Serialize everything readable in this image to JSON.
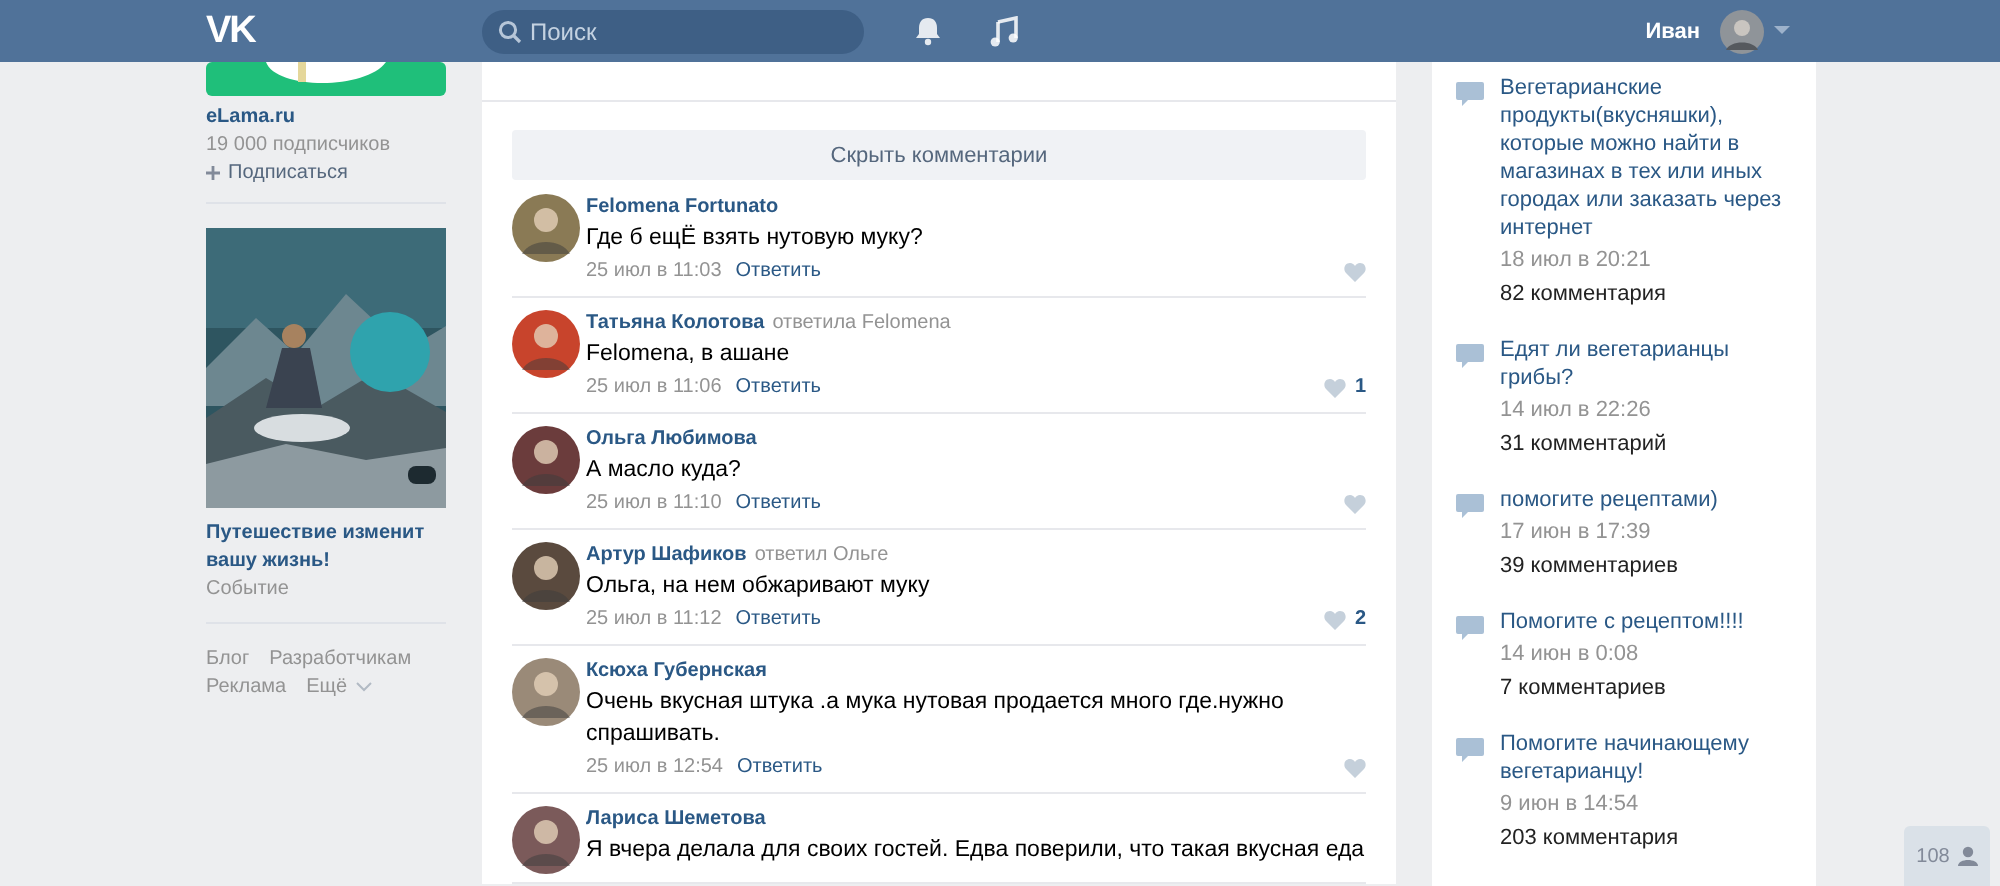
{
  "header": {
    "logo": "VK",
    "search": {
      "placeholder": "Поиск"
    },
    "user": {
      "name": "Иван"
    }
  },
  "left": {
    "group": {
      "name": "eLama.ru",
      "subscribers": "19 000 подписчиков",
      "subscribe": "Подписаться"
    },
    "ad": {
      "title": "Путешествие изменит вашу жизнь!",
      "type": "Событие"
    },
    "footer_links": [
      {
        "label": "Блог",
        "dropdown": false
      },
      {
        "label": "Разработчикам",
        "dropdown": false
      },
      {
        "label": "Реклама",
        "dropdown": false
      },
      {
        "label": "Ещё",
        "dropdown": true
      }
    ]
  },
  "post": {
    "hide_comments": "Скрыть комментарии",
    "comments": [
      {
        "author": "Felomena Fortunato",
        "text": "Где б ещЁ взять нутовую муку?",
        "date": "25 июл в 11:03",
        "reply": "Ответить"
      },
      {
        "author": "Татьяна Колотова",
        "reply_to": "ответила Felomena",
        "text": "Felomena, в ашане",
        "date": "25 июл в 11:06",
        "reply": "Ответить",
        "likes": "1"
      },
      {
        "author": "Ольга Любимова",
        "text": "А масло куда?",
        "date": "25 июл в 11:10",
        "reply": "Ответить"
      },
      {
        "author": "Артур Шафиков",
        "reply_to": "ответил Ольге",
        "text": "Ольга, на нем обжаривают муку",
        "date": "25 июл в 11:12",
        "reply": "Ответить",
        "likes": "2"
      },
      {
        "author": "Ксюха Губернская",
        "text": "Очень вкусная штука .а мука нутовая продается много где.нужно спрашивать.",
        "date": "25 июл в 12:54",
        "reply": "Ответить"
      },
      {
        "author": "Лариса Шеметова",
        "text": "Я вчера делала для своих гостей. Едва поверили, что такая вкусная еда"
      }
    ]
  },
  "topics": [
    {
      "title": "Вегетарианские продукты(вкусняшки), которые можно найти в магазинах в тех или иных городах или заказать через интернет",
      "date": "18 июл в 20:21",
      "comments": "82 комментария"
    },
    {
      "title": "Едят ли вегетарианцы грибы?",
      "date": "14 июл в 22:26",
      "comments": "31 комментарий"
    },
    {
      "title": "помогите рецептами)",
      "date": "17 июн в 17:39",
      "comments": "39 комментариев"
    },
    {
      "title": "Помогите с рецептом!!!!",
      "date": "14 июн в 0:08",
      "comments": "7 комментариев"
    },
    {
      "title": "Помогите начинающему вегетарианцу!",
      "date": "9 июн в 14:54",
      "comments": "203 комментария"
    }
  ],
  "online_badge": {
    "count": "108"
  }
}
